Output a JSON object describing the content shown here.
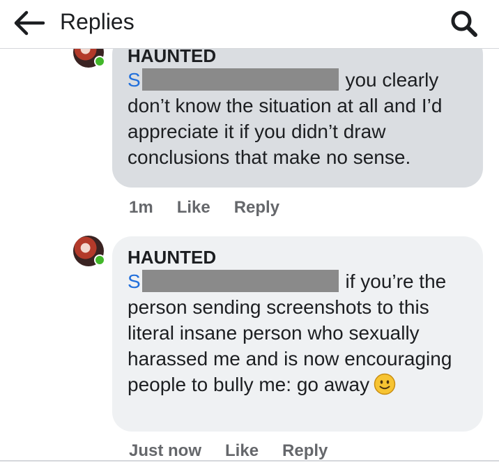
{
  "header": {
    "title": "Replies",
    "back_icon": "arrow-left-icon",
    "search_icon": "search-icon"
  },
  "comments": [
    {
      "author": "HAUNTED",
      "mention_initial": "S",
      "text": "you clearly don’t know the situation at all and I’d appreciate it if you didn’t draw conclusions that make no sense.",
      "time": "1m",
      "like_label": "Like",
      "reply_label": "Reply"
    },
    {
      "author": "HAUNTED",
      "mention_initial": "S",
      "text": "if you’re the person sending screenshots to this literal insane person who sexually harassed me and is now encouraging people to bully me: go away",
      "emoji": "slightly-smiling-face-icon",
      "time": "Just now",
      "like_label": "Like",
      "reply_label": "Reply"
    }
  ],
  "colors": {
    "bubble_highlighted": "#dadde1",
    "bubble": "#eff1f3",
    "mention": "#216fdb",
    "meta_text": "#65676b",
    "presence": "#42b72a"
  }
}
